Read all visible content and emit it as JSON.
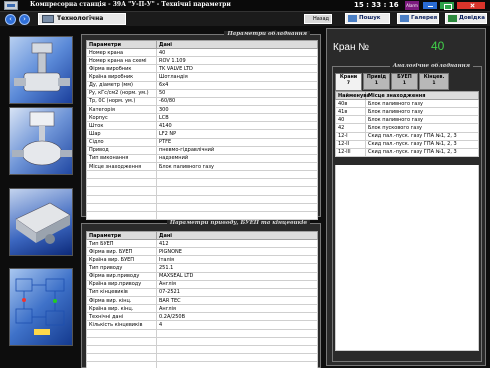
{
  "window": {
    "title": "Компресорна станція - 39А \"У-П-У\"  -    Технічні параметри",
    "time": "15 : 33 : 16",
    "alarm_label": "Alarm"
  },
  "toolbar": {
    "tab_label": "Технологічна схема",
    "back_label": "Назад",
    "search_label": "Пошук",
    "gallery_label": "Галерея",
    "help_label": "Довідка"
  },
  "equipment": {
    "title": "Параметри обладнання",
    "headers": [
      "Параметри",
      "Дані"
    ],
    "rows": [
      [
        "Номер крана",
        "40"
      ],
      [
        "Номер крана на схемі",
        "ROV 1.109"
      ],
      [
        "Фірма виробник",
        "TK VALVE LTD"
      ],
      [
        "Країна виробник",
        "Шотландія"
      ],
      [
        "Ду, діаметр (мм)",
        "6х4"
      ],
      [
        "Ру, кГс/см2 (норм. ум.)",
        "50"
      ],
      [
        "Тр, 0С (норм. ум.)",
        "-60/80"
      ],
      [
        "Категорія",
        "300"
      ],
      [
        "Корпус",
        "LCB"
      ],
      [
        "Шток",
        "4140"
      ],
      [
        "Шар",
        "LF2 NP"
      ],
      [
        "Сідло",
        "PTFE"
      ],
      [
        "Привод",
        "пневмо-гідравлічний"
      ],
      [
        "Тип виконання",
        "надземний"
      ],
      [
        "Місце знаходження",
        "Блок паливного газу"
      ],
      [
        "",
        ""
      ],
      [
        "",
        ""
      ],
      [
        "",
        ""
      ],
      [
        "",
        ""
      ],
      [
        "",
        ""
      ],
      [
        "",
        ""
      ]
    ]
  },
  "drive": {
    "title": "Параметри приводу, БУЕП та кінцевиків",
    "headers": [
      "Параметри",
      "Дані"
    ],
    "rows": [
      [
        "Тип БУЕП",
        "412"
      ],
      [
        "Фірма вир. БУЕП",
        "PIGNONE"
      ],
      [
        "Країна вир. БУЕП",
        "Італія"
      ],
      [
        "Тип приводу",
        "251.1"
      ],
      [
        "Фірма вир.приводу",
        "MAXSEAL LTD"
      ],
      [
        "Країна вир.приводу",
        "Англія"
      ],
      [
        "Тип кінцевиків",
        "07-2521"
      ],
      [
        "Фірма вир. кінц.",
        "BAR TEC"
      ],
      [
        "Країна вир. кінц.",
        "Англія"
      ],
      [
        "Технічні дані",
        "0.2А/250В"
      ],
      [
        "Кількість кінцевиків",
        "4"
      ],
      [
        "",
        ""
      ],
      [
        "",
        ""
      ],
      [
        "",
        ""
      ],
      [
        "",
        ""
      ],
      [
        "",
        ""
      ]
    ]
  },
  "crane": {
    "label": "Кран №",
    "number": "40"
  },
  "analog": {
    "title": "Аналогічне обладнання",
    "tabs": [
      {
        "label": "Крани",
        "count": "7"
      },
      {
        "label": "Привід",
        "count": "1"
      },
      {
        "label": "БУЕП",
        "count": "1"
      },
      {
        "label": "Кінцев.",
        "count": "1"
      }
    ],
    "headers": [
      "Найменува",
      "Місце знаходження"
    ],
    "rows": [
      [
        "40в",
        "Блок паливного газу"
      ],
      [
        "41в",
        "Блок паливного газу"
      ],
      [
        "40",
        "Блок паливного газу"
      ],
      [
        "42",
        "Блок пускового газу"
      ],
      [
        "12-І",
        "Скид пал.-пуск. газу ГПА №1, 2, 3"
      ],
      [
        "12-ІІ",
        "Скид пал.-пуск. газу ГПА №1, 2, 3"
      ],
      [
        "12-ІІІ",
        "Скид пал.-пуск. газу ГПА №1, 2, 3"
      ]
    ]
  }
}
